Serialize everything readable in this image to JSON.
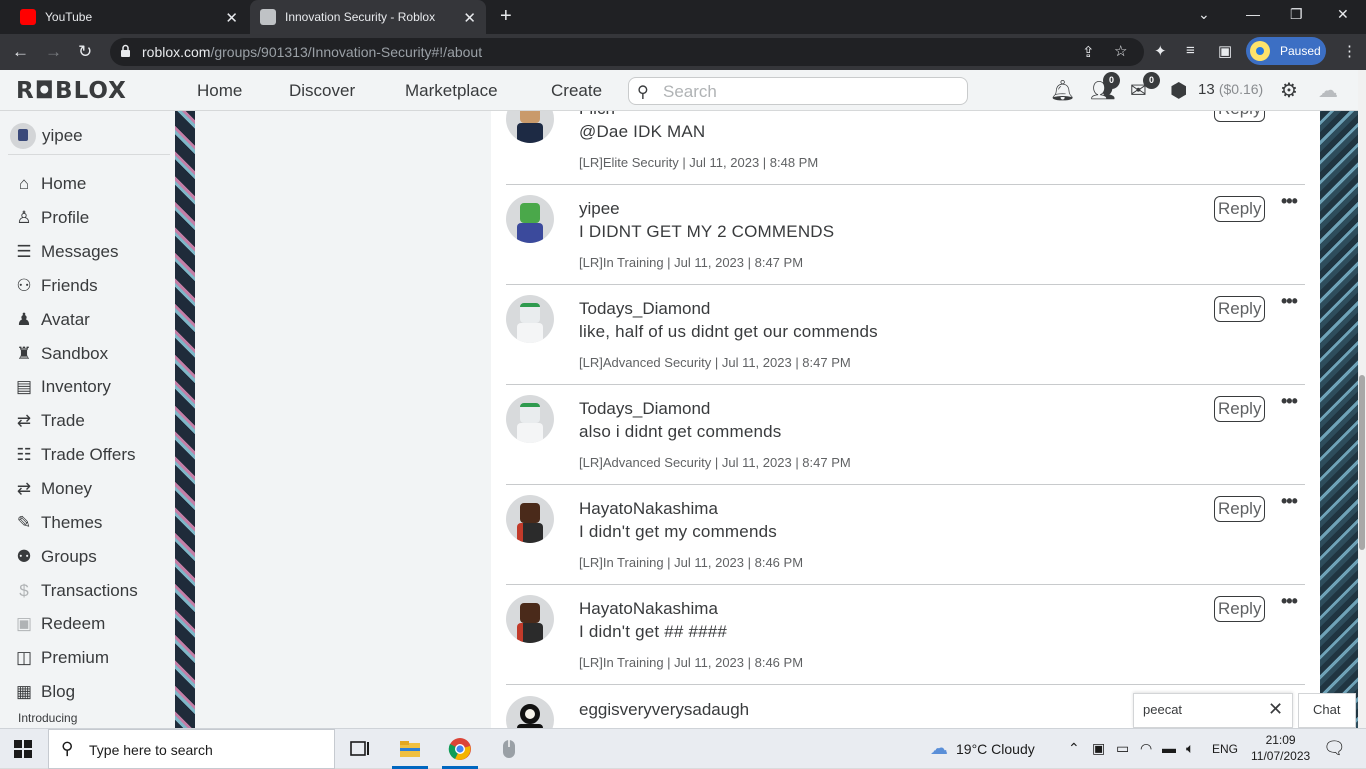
{
  "browser": {
    "tabs": [
      {
        "title": "YouTube"
      },
      {
        "title": "Innovation Security - Roblox"
      }
    ],
    "url_host": "roblox.com",
    "url_path": "/groups/901313/Innovation-Security#!/about",
    "profile_status": "Paused"
  },
  "header": {
    "logo": "R◘BLOX",
    "nav": [
      "Home",
      "Discover",
      "Marketplace",
      "Create"
    ],
    "search_placeholder": "Search",
    "friend_badge": "0",
    "message_badge": "0",
    "robux_amount": "13",
    "robux_usd": "($0.16)"
  },
  "sidebar": {
    "username": "yipee",
    "items": [
      {
        "label": "Home",
        "icon": "home-icon"
      },
      {
        "label": "Profile",
        "icon": "profile-icon"
      },
      {
        "label": "Messages",
        "icon": "messages-icon"
      },
      {
        "label": "Friends",
        "icon": "friends-icon"
      },
      {
        "label": "Avatar",
        "icon": "avatar-icon"
      },
      {
        "label": "Sandbox",
        "icon": "sandbox-icon"
      },
      {
        "label": "Inventory",
        "icon": "inventory-icon"
      },
      {
        "label": "Trade",
        "icon": "trade-icon"
      },
      {
        "label": "Trade Offers",
        "icon": "trade-offers-icon"
      },
      {
        "label": "Money",
        "icon": "money-icon"
      },
      {
        "label": "Themes",
        "icon": "themes-icon"
      },
      {
        "label": "Groups",
        "icon": "groups-icon"
      },
      {
        "label": "Transactions",
        "icon": "transactions-icon"
      },
      {
        "label": "Redeem",
        "icon": "redeem-icon"
      },
      {
        "label": "Premium",
        "icon": "premium-icon"
      },
      {
        "label": "Blog",
        "icon": "blog-icon"
      }
    ],
    "introducing": "Introducing"
  },
  "comments": {
    "reply_label": "Reply",
    "items": [
      {
        "author": "Filch",
        "mention": "@Dae",
        "text": " IDK MAN",
        "meta": "[LR]Elite Security | Jul 11, 2023 | 8:48 PM"
      },
      {
        "author": "yipee",
        "mention": "",
        "text": "I DIDNT GET MY 2 COMMENDS",
        "meta": "[LR]In Training | Jul 11, 2023 | 8:47 PM"
      },
      {
        "author": "Todays_Diamond",
        "mention": "",
        "text": "like, half of us didnt get our commends",
        "meta": "[LR]Advanced Security | Jul 11, 2023 | 8:47 PM"
      },
      {
        "author": "Todays_Diamond",
        "mention": "",
        "text": "also i didnt get commends",
        "meta": "[LR]Advanced Security | Jul 11, 2023 | 8:47 PM"
      },
      {
        "author": "HayatoNakashima",
        "mention": "",
        "text": "I didn't get my commends",
        "meta": "[LR]In Training | Jul 11, 2023 | 8:46 PM"
      },
      {
        "author": "HayatoNakashima",
        "mention": "",
        "text": "I didn't get ## ####",
        "meta": "[LR]In Training | Jul 11, 2023 | 8:46 PM"
      },
      {
        "author": "eggisveryverysadaugh",
        "mention": "",
        "text": "",
        "meta": ""
      }
    ]
  },
  "chat": {
    "open_conversation": "peecat",
    "button_label": "Chat"
  },
  "taskbar": {
    "search_placeholder": "Type here to search",
    "weather": "19°C  Cloudy",
    "language": "ENG",
    "time": "21:09",
    "date": "11/07/2023"
  }
}
